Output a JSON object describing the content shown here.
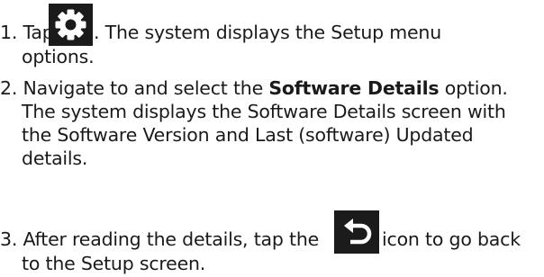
{
  "steps": {
    "step1": {
      "prefix": "1. Tap ",
      "icon": "gear-icon",
      "suffix": ". The system displays the Setup menu",
      "cont": "options."
    },
    "step2": {
      "prefix": "2. Navigate to and select the ",
      "bold": "Software Details",
      "suffix": " option.",
      "line2": "The system displays the Software Details screen with",
      "line3": "the Software Version and Last (software) Updated",
      "line4": "details."
    },
    "step3": {
      "prefix": "3. After reading the details, tap the ",
      "icon": "back-arrow-icon",
      "suffix": " icon to go back",
      "cont": "to the Setup screen."
    }
  },
  "colors": {
    "text": "#1a1a1a",
    "icon_bg": "#1b1b1b",
    "icon_fg": "#ffffff"
  }
}
